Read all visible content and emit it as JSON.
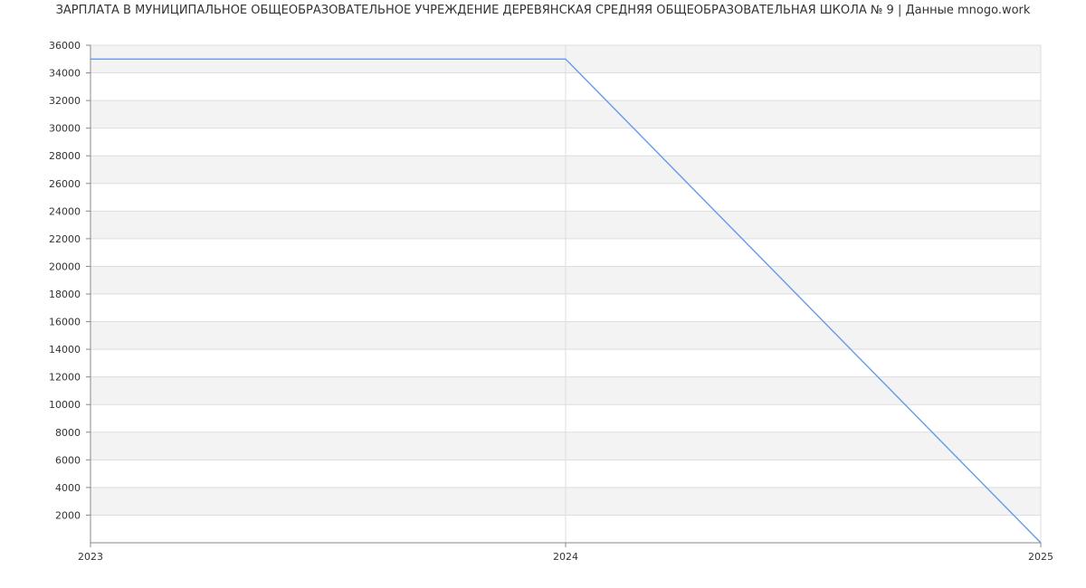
{
  "chart_data": {
    "type": "line",
    "title": "ЗАРПЛАТА В МУНИЦИПАЛЬНОЕ ОБЩЕОБРАЗОВАТЕЛЬНОЕ УЧРЕЖДЕНИЕ ДЕРЕВЯНСКАЯ СРЕДНЯЯ ОБЩЕОБРАЗОВАТЕЛЬНАЯ ШКОЛА № 9 | Данные mnogo.work",
    "xlabel": "",
    "ylabel": "",
    "x": [
      "2023",
      "2024",
      "2025"
    ],
    "series": [
      {
        "values": [
          35000,
          35000,
          0
        ]
      }
    ],
    "ylim": [
      0,
      36000
    ],
    "yticks": [
      2000,
      4000,
      6000,
      8000,
      10000,
      12000,
      14000,
      16000,
      18000,
      20000,
      22000,
      24000,
      26000,
      28000,
      30000,
      32000,
      34000,
      36000
    ],
    "grid": true,
    "legend": "none",
    "colors": {
      "line": "#6699ee",
      "band": "#f3f3f3",
      "grid": "#dddddd",
      "axis": "#888888"
    }
  }
}
